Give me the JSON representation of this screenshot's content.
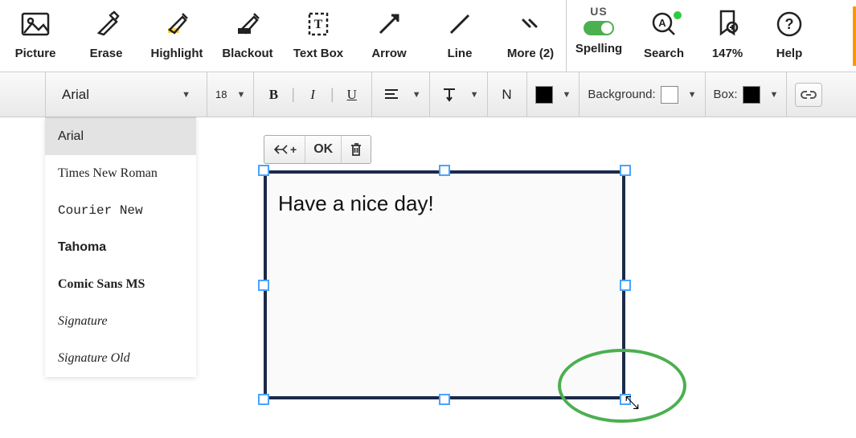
{
  "toolbar": {
    "picture": "Picture",
    "erase": "Erase",
    "highlight": "Highlight",
    "blackout": "Blackout",
    "textbox": "Text Box",
    "arrow": "Arrow",
    "line": "Line",
    "more": "More (2)",
    "spelling_lang": "US",
    "spelling": "Spelling",
    "search": "Search",
    "zoom": "147%",
    "help": "Help"
  },
  "format": {
    "font_name": "Arial",
    "font_size": "18",
    "align_btn": "≡",
    "valign_btn": "⊤",
    "normalize": "N",
    "bg_label": "Background:",
    "box_label": "Box:"
  },
  "context_bar": {
    "move": "⤡",
    "ok": "OK",
    "delete": "🗑"
  },
  "textbox": {
    "content": "Have a nice day!"
  },
  "font_dropdown": {
    "options": [
      "Arial",
      "Times New Roman",
      "Courier New",
      "Tahoma",
      "Comic Sans MS",
      "Signature",
      "Signature Old"
    ],
    "selected": "Arial"
  }
}
